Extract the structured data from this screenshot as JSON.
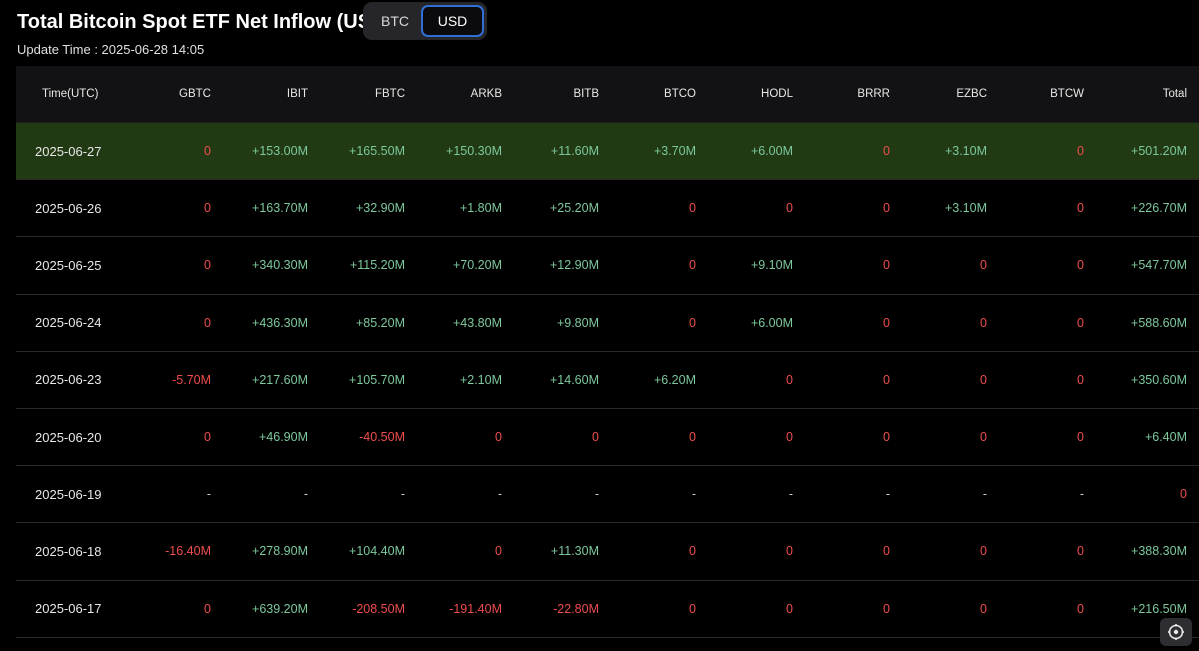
{
  "header": {
    "title": "Total Bitcoin Spot ETF Net Inflow (USD)",
    "update_time": "Update Time : 2025-06-28 14:05"
  },
  "toggle": {
    "btc_label": "BTC",
    "usd_label": "USD",
    "selected": "USD"
  },
  "colors": {
    "positive": "#7dc89d",
    "negative": "#ee4d4d",
    "highlight_row": "#213a13",
    "toggle_active_border": "#2f6fd6"
  },
  "table": {
    "columns": [
      "Time(UTC)",
      "GBTC",
      "IBIT",
      "FBTC",
      "ARKB",
      "BITB",
      "BTCO",
      "HODL",
      "BRRR",
      "EZBC",
      "BTCW",
      "Total"
    ],
    "rows": [
      [
        "2025-06-27",
        "0",
        "+153.00M",
        "+165.50M",
        "+150.30M",
        "+11.60M",
        "+3.70M",
        "+6.00M",
        "0",
        "+3.10M",
        "0",
        "+501.20M"
      ],
      [
        "2025-06-26",
        "0",
        "+163.70M",
        "+32.90M",
        "+1.80M",
        "+25.20M",
        "0",
        "0",
        "0",
        "+3.10M",
        "0",
        "+226.70M"
      ],
      [
        "2025-06-25",
        "0",
        "+340.30M",
        "+115.20M",
        "+70.20M",
        "+12.90M",
        "0",
        "+9.10M",
        "0",
        "0",
        "0",
        "+547.70M"
      ],
      [
        "2025-06-24",
        "0",
        "+436.30M",
        "+85.20M",
        "+43.80M",
        "+9.80M",
        "0",
        "+6.00M",
        "0",
        "0",
        "0",
        "+588.60M"
      ],
      [
        "2025-06-23",
        "-5.70M",
        "+217.60M",
        "+105.70M",
        "+2.10M",
        "+14.60M",
        "+6.20M",
        "0",
        "0",
        "0",
        "0",
        "+350.60M"
      ],
      [
        "2025-06-20",
        "0",
        "+46.90M",
        "-40.50M",
        "0",
        "0",
        "0",
        "0",
        "0",
        "0",
        "0",
        "+6.40M"
      ],
      [
        "2025-06-19",
        "-",
        "-",
        "-",
        "-",
        "-",
        "-",
        "-",
        "-",
        "-",
        "-",
        "0"
      ],
      [
        "2025-06-18",
        "-16.40M",
        "+278.90M",
        "+104.40M",
        "0",
        "+11.30M",
        "0",
        "0",
        "0",
        "0",
        "0",
        "+388.30M"
      ],
      [
        "2025-06-17",
        "0",
        "+639.20M",
        "-208.50M",
        "-191.40M",
        "-22.80M",
        "0",
        "0",
        "0",
        "0",
        "0",
        "+216.50M"
      ]
    ]
  },
  "widget": {
    "icon": "help-settings-icon"
  }
}
